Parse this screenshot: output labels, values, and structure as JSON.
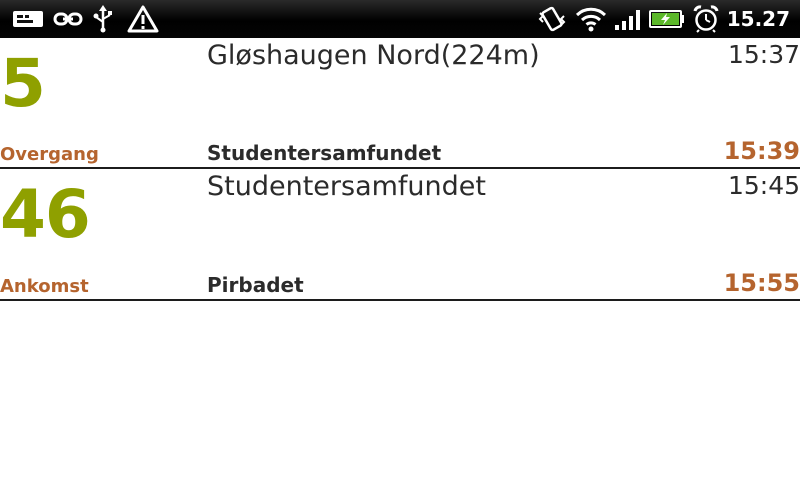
{
  "status_bar": {
    "time": "15.27",
    "left_icons": [
      "keyboard-notification-icon",
      "link-icon",
      "usb-icon",
      "warning-icon"
    ],
    "right_icons": [
      "vibrate-icon",
      "wifi-icon",
      "signal-icon",
      "battery-charging-icon",
      "alarm-icon"
    ]
  },
  "colors": {
    "line_number": "#8fa000",
    "accent": "#b5642e",
    "text": "#2b2b2b"
  },
  "routes": [
    {
      "line": "5",
      "type": "Overgang",
      "from": "Gløshaugen Nord(224m)",
      "departure": "15:37",
      "to": "Studentersamfundet",
      "arrival": "15:39"
    },
    {
      "line": "46",
      "type": "Ankomst",
      "from": "Studentersamfundet",
      "departure": "15:45",
      "to": "Pirbadet",
      "arrival": "15:55"
    }
  ]
}
